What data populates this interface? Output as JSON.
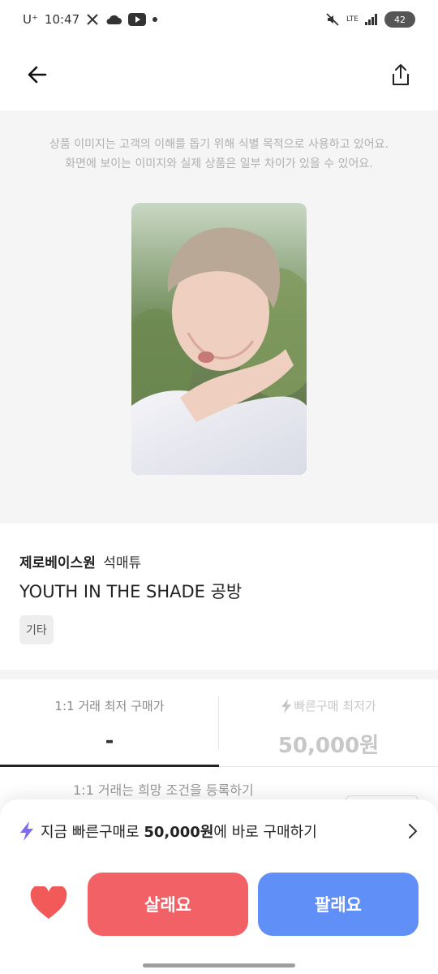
{
  "status_bar": {
    "carrier": "U⁺",
    "time": "10:47",
    "network": "LTE",
    "battery": "42"
  },
  "header": {
    "back_icon": "arrow-left-icon",
    "share_icon": "share-icon"
  },
  "image_section": {
    "notice_line1": "상품 이미지는 고객의 이해를 돕기 위해 식별 목적으로 사용하고 있어요.",
    "notice_line2": "화면에 보이는 이미지와 실제 상품은 일부 차이가 있을 수 있어요."
  },
  "product": {
    "brand": "제로베이스원",
    "model": "석매튜",
    "title": "YOUTH IN THE SHADE 공방",
    "tag": "기타"
  },
  "price_tabs": [
    {
      "label": "1:1 거래 최저 구매가",
      "value": "-"
    },
    {
      "label": "빠른구매 최저가",
      "value": "50,000원"
    }
  ],
  "peek_text": "1:1 거래는 희망 조건을 등록하기",
  "bottom_sheet": {
    "quick_prefix": "지금 빠른구매로 ",
    "quick_price": "50,000원",
    "quick_suffix": "에 바로 구매하기",
    "buy_label": "살래요",
    "sell_label": "팔래요"
  },
  "colors": {
    "buy": "#f26165",
    "sell": "#5f8ff7",
    "bolt": "#7b6cf0",
    "heart": "#f25a5a"
  }
}
